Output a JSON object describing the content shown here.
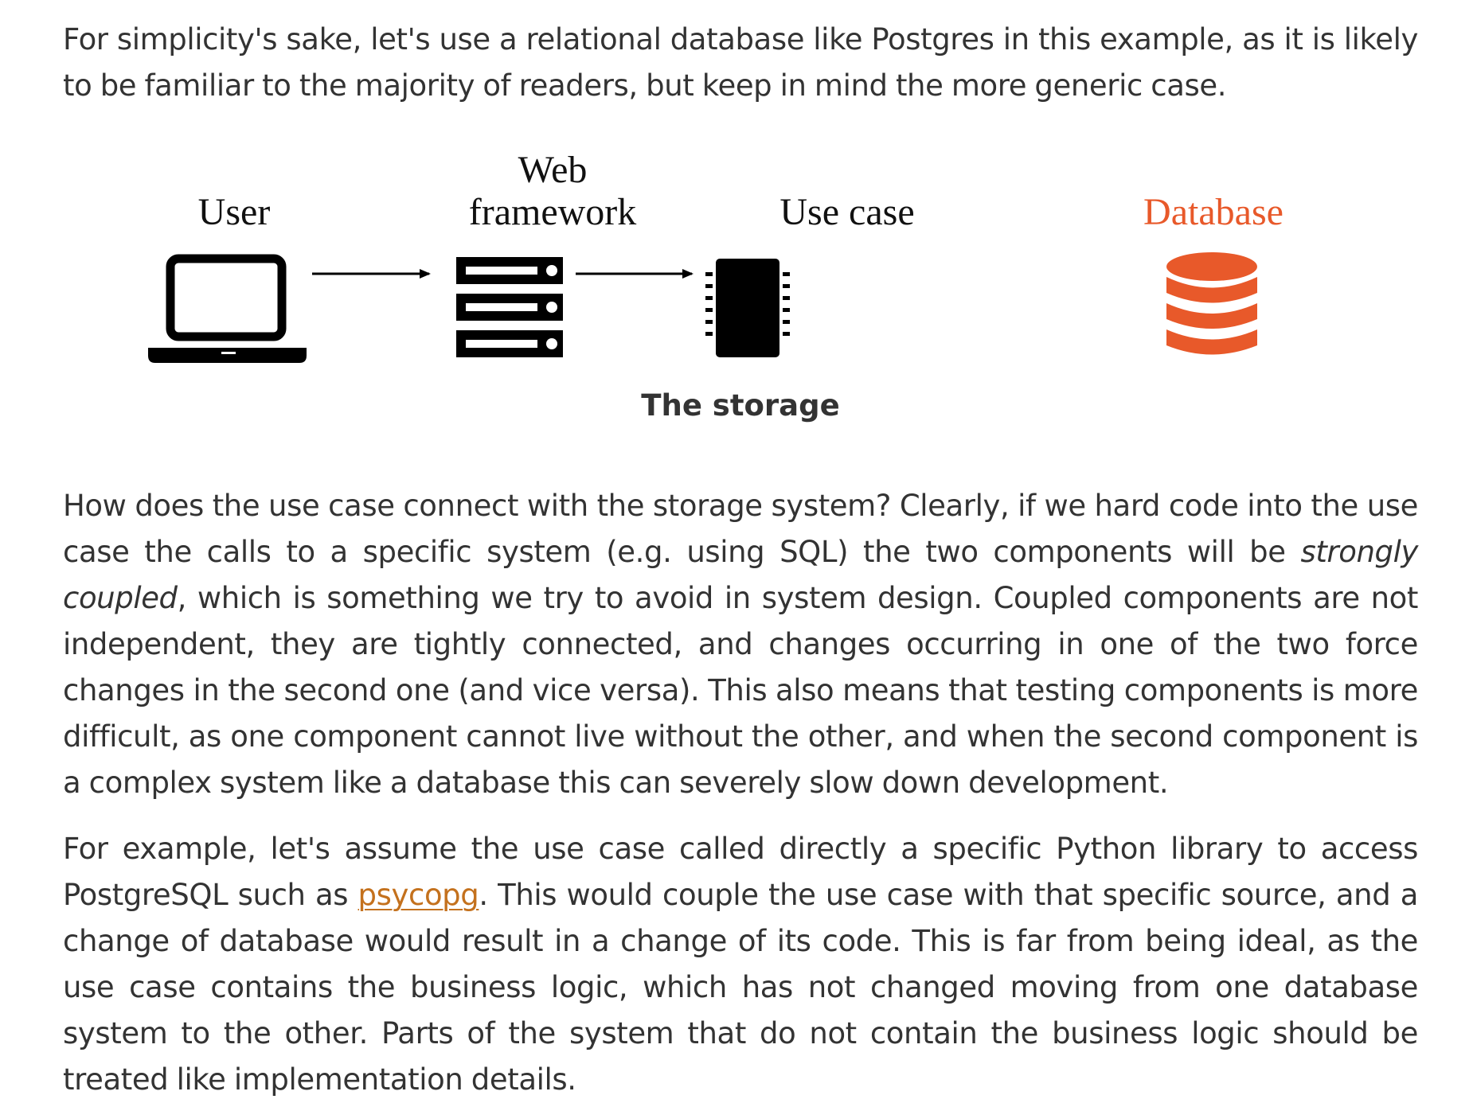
{
  "intro_text": "For simplicity's sake, let's use a relational database like Postgres in this example, as it is likely to be familiar to the majority of readers, but keep in mind the more generic case.",
  "diagram": {
    "labels": {
      "user": "User",
      "web_framework_line1": "Web",
      "web_framework_line2": "framework",
      "use_case": "Use case",
      "database": "Database"
    },
    "colors": {
      "ink": "#000000",
      "database": "#e8592a"
    },
    "icons": [
      "laptop-icon",
      "server-rack-icon",
      "chip-icon",
      "database-icon"
    ]
  },
  "caption": "The storage",
  "paragraph1": {
    "before_em": "How does the use case connect with the storage system? Clearly, if we hard code into the use case the calls to a specific system (e.g. using SQL) the two components will be ",
    "em": "strongly coupled",
    "after_em": ", which is something we try to avoid in system design. Coupled components are not independent, they are tightly connected, and changes occurring in one of the two force changes in the second one (and vice versa). This also means that testing components is more difficult, as one component cannot live without the other, and when the second component is a complex system like a database this can severely slow down development."
  },
  "paragraph2": {
    "before_link": "For example, let's assume the use case called directly a specific Python library to access PostgreSQL such as ",
    "link_text": "psycopg",
    "after_link": ". This would couple the use case with that specific source, and a change of database would result in a change of its code. This is far from being ideal, as the use case contains the business logic, which has not changed moving from one database system to the other. Parts of the system that do not contain the business logic should be treated like implementation details."
  },
  "link_color": "#c4711d"
}
